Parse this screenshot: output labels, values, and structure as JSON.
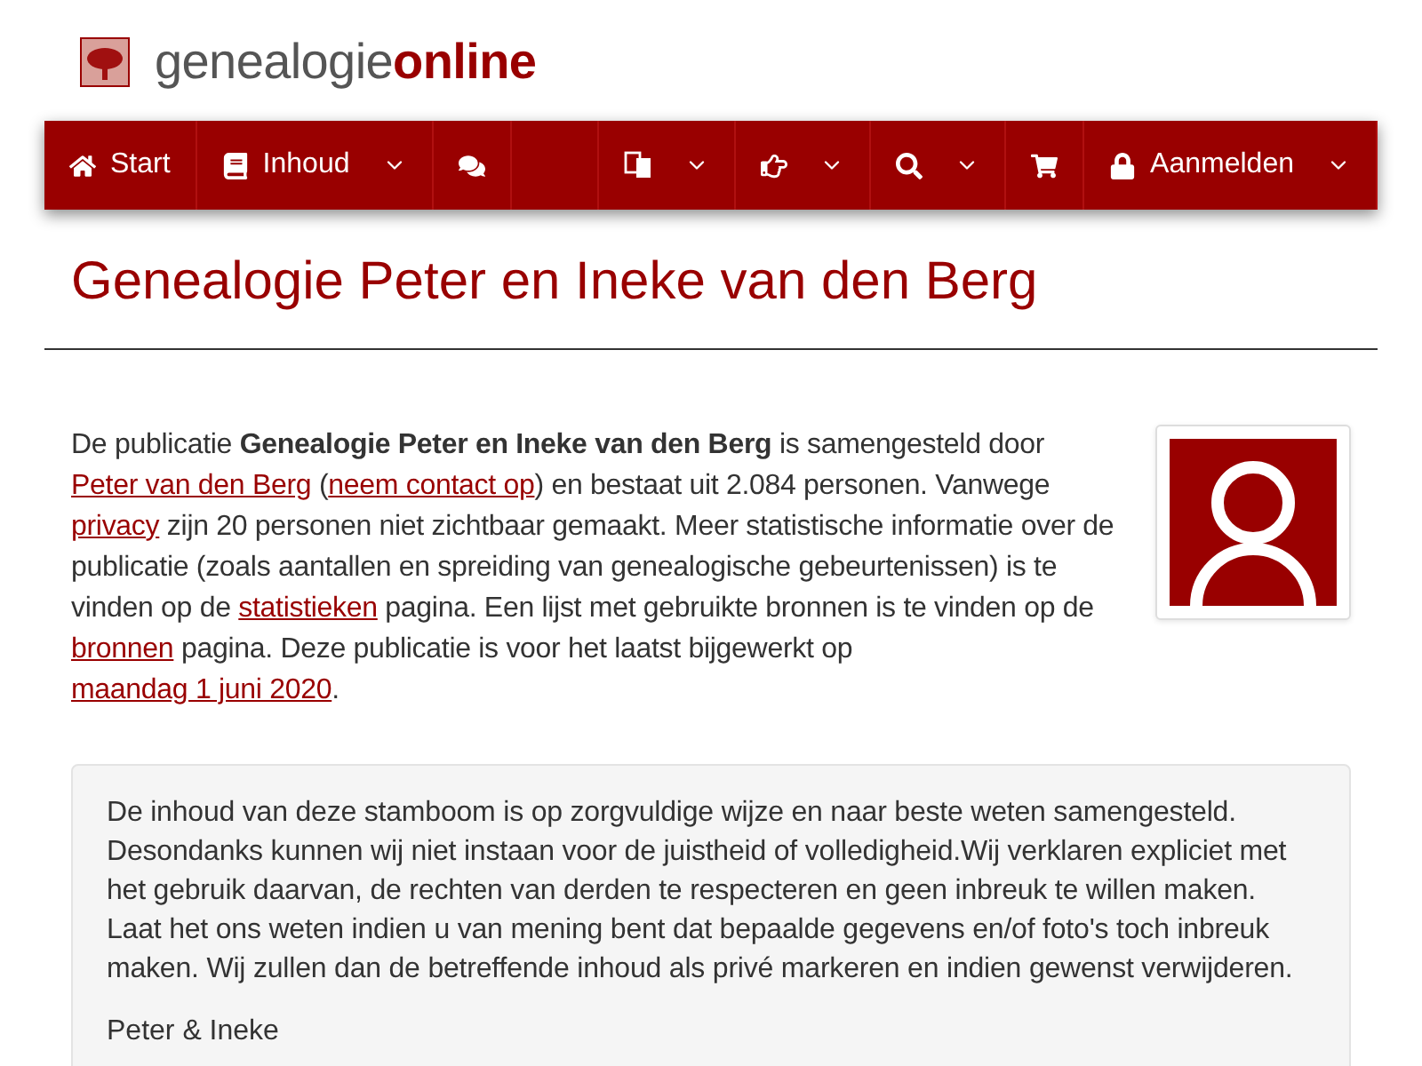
{
  "logo": {
    "text_plain": "genealogie",
    "text_bold": "online"
  },
  "nav": {
    "items": [
      {
        "kind": "home",
        "label": "Start",
        "has_menu": false
      },
      {
        "kind": "book",
        "label": "Inhoud",
        "has_menu": true
      },
      {
        "kind": "chat",
        "has_menu": false
      },
      {
        "kind": "translate",
        "has_menu": true
      },
      {
        "kind": "hand",
        "has_menu": true
      },
      {
        "kind": "search",
        "has_menu": true
      },
      {
        "kind": "cart",
        "has_menu": false
      },
      {
        "kind": "lock",
        "label": "Aanmelden",
        "has_menu": true
      }
    ]
  },
  "page_title": "Genealogie Peter en Ineke van den Berg",
  "intro": [
    {
      "kind": "text",
      "text": "De publicatie "
    },
    {
      "kind": "bold",
      "text": "Genealogie Peter en Ineke van den Berg"
    },
    {
      "kind": "text",
      "text": " is samengesteld door "
    },
    {
      "kind": "link",
      "text": "Peter van den Berg"
    },
    {
      "kind": "text",
      "text": " ("
    },
    {
      "kind": "link",
      "text": "neem contact op"
    },
    {
      "kind": "text",
      "text": ") en bestaat uit 2.084 personen. Vanwege "
    },
    {
      "kind": "link",
      "text": "privacy"
    },
    {
      "kind": "text",
      "text": " zijn 20 personen niet zichtbaar gemaakt. Meer statistische informatie over de publicatie (zoals aantallen en spreiding van genealogische gebeurtenissen) is te vinden op de "
    },
    {
      "kind": "link",
      "text": "statistieken"
    },
    {
      "kind": "text",
      "text": " pagina. Een lijst met gebruikte bronnen is te vinden op de "
    },
    {
      "kind": "link",
      "text": "bronnen"
    },
    {
      "kind": "text",
      "text": " pagina. Deze publicatie is voor het laatst bijgewerkt op "
    },
    {
      "kind": "link",
      "text": "maandag 1 juni 2020"
    },
    {
      "kind": "text",
      "text": "."
    }
  ],
  "notice": {
    "text": "De inhoud van deze stamboom is op zorgvuldige wijze en naar beste weten samengesteld. Desondanks kunnen wij niet instaan voor de juistheid of volledigheid.Wij verklaren expliciet met het gebruik daarvan, de rechten van derden te respecteren en geen inbreuk te willen maken. Laat het ons weten indien u van mening bent dat bepaalde gegevens en/of foto's toch inbreuk maken. Wij zullen dan de betreffende inhoud als privé markeren en indien gewenst verwijderen.",
    "signature": "Peter & Ineke"
  }
}
